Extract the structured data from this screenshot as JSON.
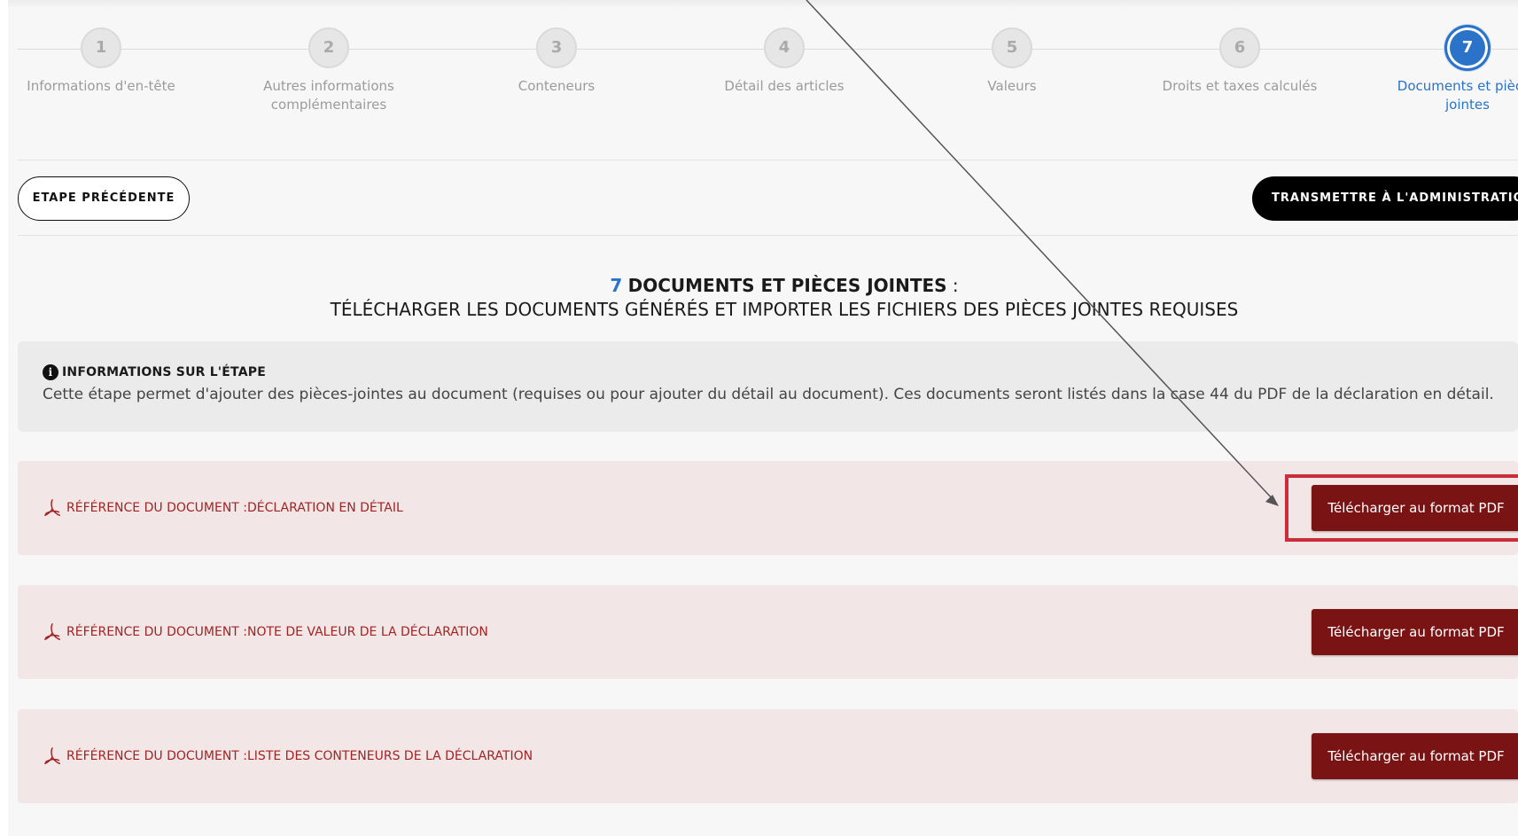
{
  "stepper": {
    "steps": [
      {
        "number": "1",
        "label": "Informations d'en-tête"
      },
      {
        "number": "2",
        "label": "Autres informations complémentaires"
      },
      {
        "number": "3",
        "label": "Conteneurs"
      },
      {
        "number": "4",
        "label": "Détail des articles"
      },
      {
        "number": "5",
        "label": "Valeurs"
      },
      {
        "number": "6",
        "label": "Droits et taxes calculés"
      },
      {
        "number": "7",
        "label": "Documents et pièces jointes"
      }
    ],
    "active_step": 7
  },
  "actions": {
    "previous_label": "ETAPE PRÉCÉDENTE",
    "transmit_label": "TRANSMETTRE À L'ADMINISTRATION"
  },
  "heading": {
    "step_number": "7",
    "title": "DOCUMENTS ET PIÈCES JOINTES",
    "colon": " :",
    "subtitle": "TÉLÉCHARGER LES DOCUMENTS GÉNÉRÉS ET IMPORTER LES FICHIERS DES PIÈCES JOINTES REQUISES"
  },
  "info": {
    "icon": "info-icon",
    "title": "INFORMATIONS SUR L'ÉTAPE",
    "text": "Cette étape permet d'ajouter des pièces-jointes au document (requises ou pour ajouter du détail au document). Ces documents seront listés dans la case 44 du PDF de la déclaration en détail."
  },
  "documents": [
    {
      "reference": "RÉFÉRENCE DU DOCUMENT :DÉCLARATION EN DÉTAIL",
      "button_label": "Télécharger au format PDF"
    },
    {
      "reference": "RÉFÉRENCE DU DOCUMENT :NOTE DE VALEUR DE LA DÉCLARATION",
      "button_label": "Télécharger au format PDF"
    },
    {
      "reference": "RÉFÉRENCE DU DOCUMENT :LISTE DES CONTENEURS DE LA DÉCLARATION",
      "button_label": "Télécharger au format PDF"
    }
  ],
  "colors": {
    "accent_blue": "#2a73c8",
    "document_red": "#a12424",
    "download_button": "#7a1414",
    "highlight_red": "#cc2d3a",
    "doc_row_background": "#f3e6e6"
  }
}
